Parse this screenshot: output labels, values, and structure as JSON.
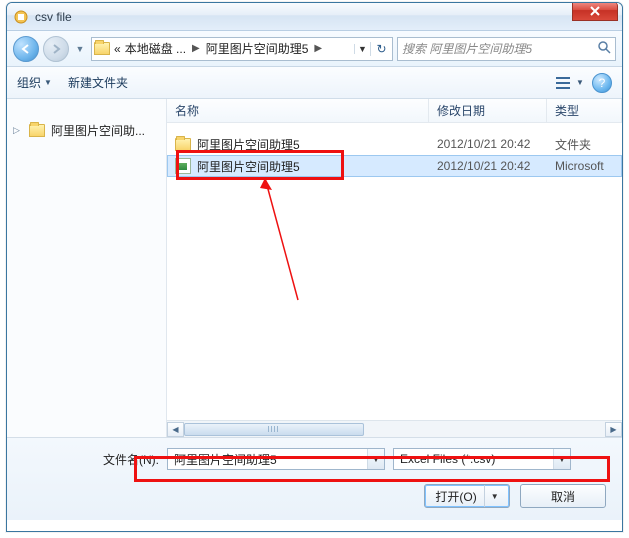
{
  "window": {
    "title": "csv file"
  },
  "breadcrumb": {
    "prefix": "«",
    "seg1": "本地磁盘 ...",
    "seg2": "阿里图片空间助理5"
  },
  "search": {
    "placeholder": "搜索 阿里图片空间助理5"
  },
  "toolbar": {
    "organize": "组织",
    "newfolder": "新建文件夹"
  },
  "columns": {
    "name": "名称",
    "date": "修改日期",
    "type": "类型"
  },
  "sidebar": {
    "item1": "阿里图片空间助..."
  },
  "rows": [
    {
      "name": "阿里图片空间助理5",
      "date": "2012/10/21 20:42",
      "type": "文件夹",
      "icon": "folder"
    },
    {
      "name": "阿里图片空间助理5",
      "date": "2012/10/21 20:42",
      "type": "Microsoft",
      "icon": "xls"
    }
  ],
  "filename": {
    "label": "文件名(N):",
    "value": "阿里图片空间助理5"
  },
  "filetype": {
    "value": "Excel Files (*.csv)"
  },
  "buttons": {
    "open": "打开(O)",
    "cancel": "取消"
  }
}
